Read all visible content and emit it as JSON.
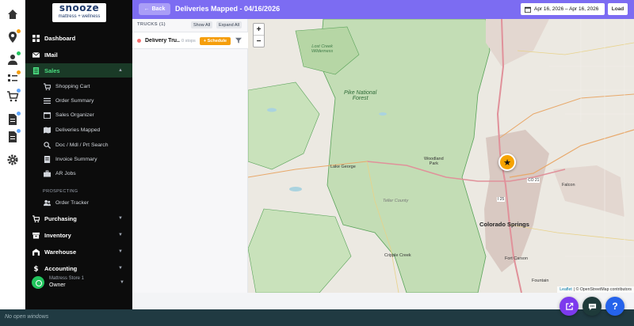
{
  "app": {
    "logo_line1": "snooze",
    "logo_line2": "mattress + wellness"
  },
  "header": {
    "back_label": "Back",
    "title": "Deliveries Mapped - 04/16/2026",
    "date_range": "Apr 16, 2026 – Apr 16, 2026",
    "load_label": "Load"
  },
  "rail": {
    "icons": [
      "home-icon",
      "map-pin-icon",
      "user-icon",
      "checklist-icon",
      "cart-icon",
      "document-icon",
      "document-icon",
      "gear-icon"
    ]
  },
  "sidebar": {
    "items": [
      {
        "label": "Dashboard"
      },
      {
        "label": "IMail"
      },
      {
        "label": "Sales"
      }
    ],
    "sales_sub": [
      {
        "label": "Shopping Cart"
      },
      {
        "label": "Order Summary"
      },
      {
        "label": "Sales Organizer"
      },
      {
        "label": "Deliveries Mapped"
      },
      {
        "label": "Doc / Mdl / Prt Search"
      },
      {
        "label": "Invoice Summary"
      },
      {
        "label": "AR Jobs"
      }
    ],
    "prospecting_label": "PROSPECTING",
    "order_tracker": "Order Tracker",
    "groups": [
      {
        "label": "Purchasing"
      },
      {
        "label": "Inventory"
      },
      {
        "label": "Warehouse"
      },
      {
        "label": "Accounting"
      }
    ],
    "user": {
      "store": "Mattress Store 1",
      "role": "Owner"
    }
  },
  "trucks": {
    "title": "TRUCKS (1)",
    "show_all": "Show All",
    "expand_all": "Expand All",
    "rows": [
      {
        "name": "Delivery Tru...",
        "stops": "0 stops",
        "schedule_label": "+ Schedule"
      }
    ]
  },
  "map": {
    "labels": {
      "lost_creek": "Lost Creek\nWilderness",
      "pike": "Pike National\nForest",
      "lake_george": "Lake George",
      "woodland_park": "Woodland\nPark",
      "teller_county": "Teller County",
      "colorado_springs": "Colorado Springs",
      "falcon": "Falcon",
      "fort_carson": "Fort Carson",
      "fountain": "Fountain",
      "cripple_creek": "Cripple Creek",
      "co21": "CO 21",
      "i25": "I 25"
    },
    "zoom_in": "+",
    "zoom_out": "−",
    "attribution_leaflet": "Leaflet",
    "attribution_rest": "| © OpenStreetMap contributors",
    "colors": {
      "forest": "#c3ddb5",
      "forest_border": "#5aa35a",
      "urban": "#d9c9c2",
      "road": "#e0919a"
    }
  },
  "taskbar": {
    "text": "No open windows"
  },
  "fabs": {
    "colors": {
      "external": "#7c3aed",
      "chat": "#1e3a3a",
      "help": "#2563eb"
    }
  }
}
